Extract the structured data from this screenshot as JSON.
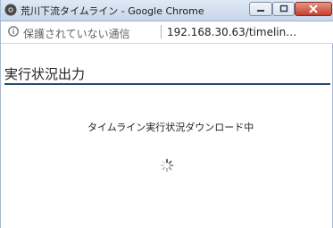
{
  "window": {
    "title": "荒川下流タイムライン - Google Chrome"
  },
  "addressbar": {
    "security_text": "保護されていない通信",
    "url": "192.168.30.63/timelin…"
  },
  "page": {
    "title": "実行状況出力",
    "status": "タイムライン実行状況ダウンロード中"
  },
  "colors": {
    "title_rule": "#2a4a75",
    "titlebar_top": "#dfe9f5",
    "close_button": "#c4402c"
  },
  "icons": {
    "app": "chrome-icon",
    "security": "info-icon",
    "loading": "spinner-icon"
  }
}
